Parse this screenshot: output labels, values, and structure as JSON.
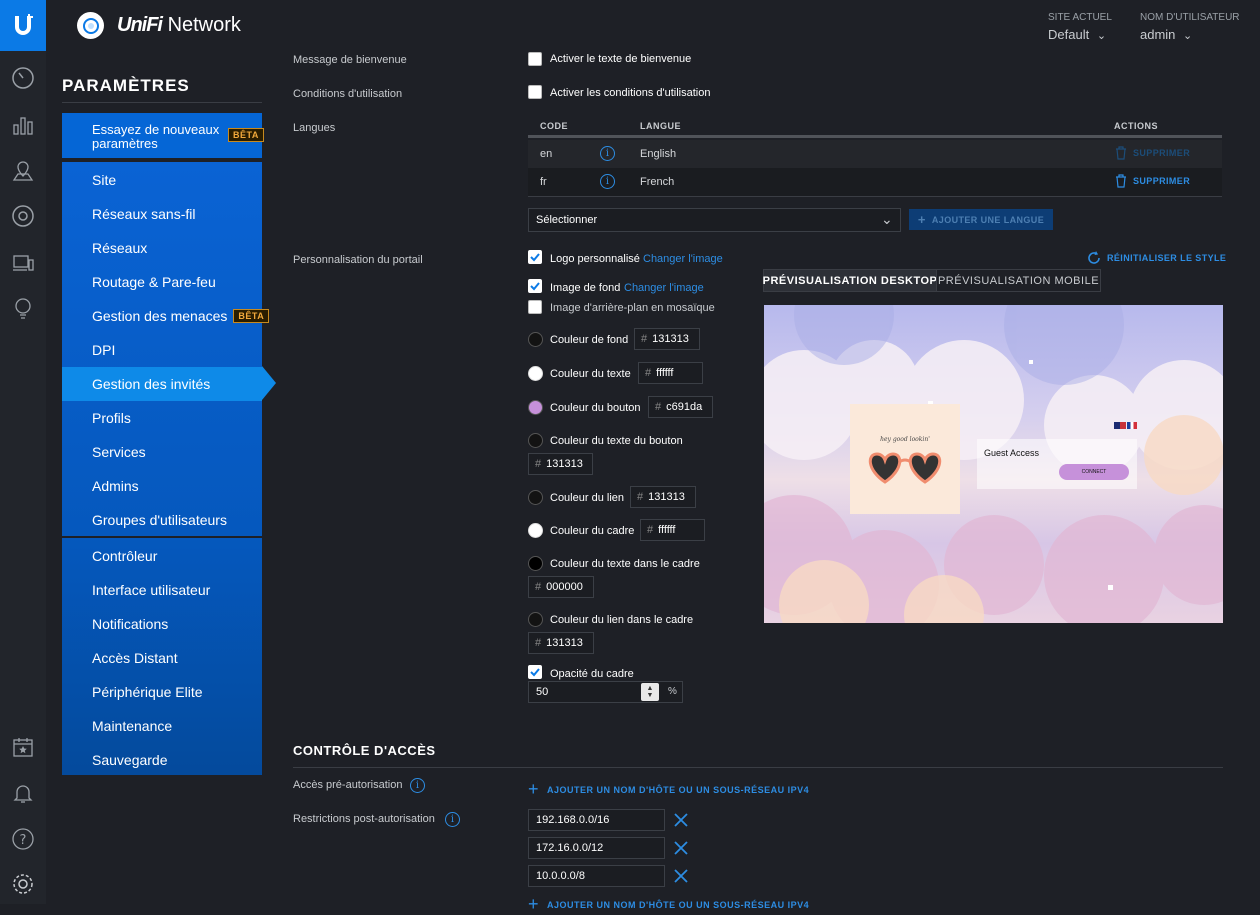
{
  "app": {
    "brand_prefix": "UniFi",
    "brand_suffix": "Network"
  },
  "header": {
    "site_label": "SITE ACTUEL",
    "site_value": "Default",
    "user_label": "NOM D'UTILISATEUR",
    "user_value": "admin"
  },
  "sidebar": {
    "title": "PARAMÈTRES",
    "new_settings_label": "Essayez de nouveaux paramètres",
    "beta": "BÊTA",
    "items": [
      {
        "label": "Site"
      },
      {
        "label": "Réseaux sans-fil"
      },
      {
        "label": "Réseaux"
      },
      {
        "label": "Routage & Pare-feu"
      },
      {
        "label": "Gestion des menaces"
      },
      {
        "label": "DPI"
      },
      {
        "label": "Gestion des invités"
      },
      {
        "label": "Profils"
      },
      {
        "label": "Services"
      },
      {
        "label": "Admins"
      },
      {
        "label": "Groupes d'utilisateurs"
      },
      {
        "label": "Contrôleur"
      },
      {
        "label": "Interface utilisateur"
      },
      {
        "label": "Notifications"
      },
      {
        "label": "Accès Distant"
      },
      {
        "label": "Périphérique Elite"
      },
      {
        "label": "Maintenance"
      },
      {
        "label": "Sauvegarde"
      }
    ],
    "active_item": "Gestion des invités"
  },
  "welcome": {
    "label": "Message de bienvenue",
    "checkbox": "Activer le texte de bienvenue",
    "checked": false
  },
  "terms": {
    "label": "Conditions d'utilisation",
    "checkbox": "Activer les conditions d'utilisation",
    "checked": false
  },
  "languages": {
    "label": "Langues",
    "headers": {
      "code": "CODE",
      "lang": "LANGUE",
      "actions": "ACTIONS"
    },
    "rows": [
      {
        "code": "en",
        "lang": "English",
        "action": "SUPPRIMER",
        "enabled": false
      },
      {
        "code": "fr",
        "lang": "French",
        "action": "SUPPRIMER",
        "enabled": true
      }
    ],
    "select_value": "Sélectionner",
    "add_button": "AJOUTER UNE LANGUE"
  },
  "portal": {
    "label": "Personnalisation du portail",
    "reset_style": "RÉINITIALISER LE STYLE",
    "logo_checkbox": "Logo personnalisé",
    "logo_checked": true,
    "change_image": "Changer l'image",
    "bg_checkbox": "Image de fond",
    "bg_checked": true,
    "tile_checkbox": "Image d'arrière-plan en mosaïque",
    "tile_checked": false,
    "colors": [
      {
        "label": "Couleur de fond",
        "hex": "131313",
        "swatch": "#131313"
      },
      {
        "label": "Couleur du texte",
        "hex": "ffffff",
        "swatch": "#ffffff"
      },
      {
        "label": "Couleur du bouton",
        "hex": "c691da",
        "swatch": "#c691da"
      },
      {
        "label": "Couleur du texte du bouton",
        "hex": "131313",
        "swatch": "#131313"
      },
      {
        "label": "Couleur du lien",
        "hex": "131313",
        "swatch": "#131313"
      },
      {
        "label": "Couleur du cadre",
        "hex": "ffffff",
        "swatch": "#ffffff"
      },
      {
        "label": "Couleur du texte dans le cadre",
        "hex": "000000",
        "swatch": "#000000"
      },
      {
        "label": "Couleur du lien dans le cadre",
        "hex": "131313",
        "swatch": "#131313"
      }
    ],
    "opacity_checkbox": "Opacité du cadre",
    "opacity_checked": true,
    "opacity_value": "50",
    "opacity_unit": "%",
    "tab_desktop": "PRÉVISUALISATION DESKTOP",
    "tab_mobile": "PRÉVISUALISATION MOBILE",
    "preview": {
      "logo_text": "hey good lookin'",
      "guest_title": "Guest Access",
      "connect": "CONNECT"
    }
  },
  "access": {
    "title": "CONTRÔLE D'ACCÈS",
    "pre_auth_label": "Accès pré-autorisation",
    "post_auth_label": "Restrictions post-autorisation",
    "add_link": "AJOUTER UN NOM D'HÔTE OU UN SOUS-RÉSEAU IPV4",
    "subnets": [
      "192.168.0.0/16",
      "172.16.0.0/12",
      "10.0.0.0/8"
    ]
  },
  "colors": {
    "accent": "#0b7ae6",
    "link": "#2d8de3",
    "bg": "#1e2026",
    "beta": "#f2a93b"
  }
}
